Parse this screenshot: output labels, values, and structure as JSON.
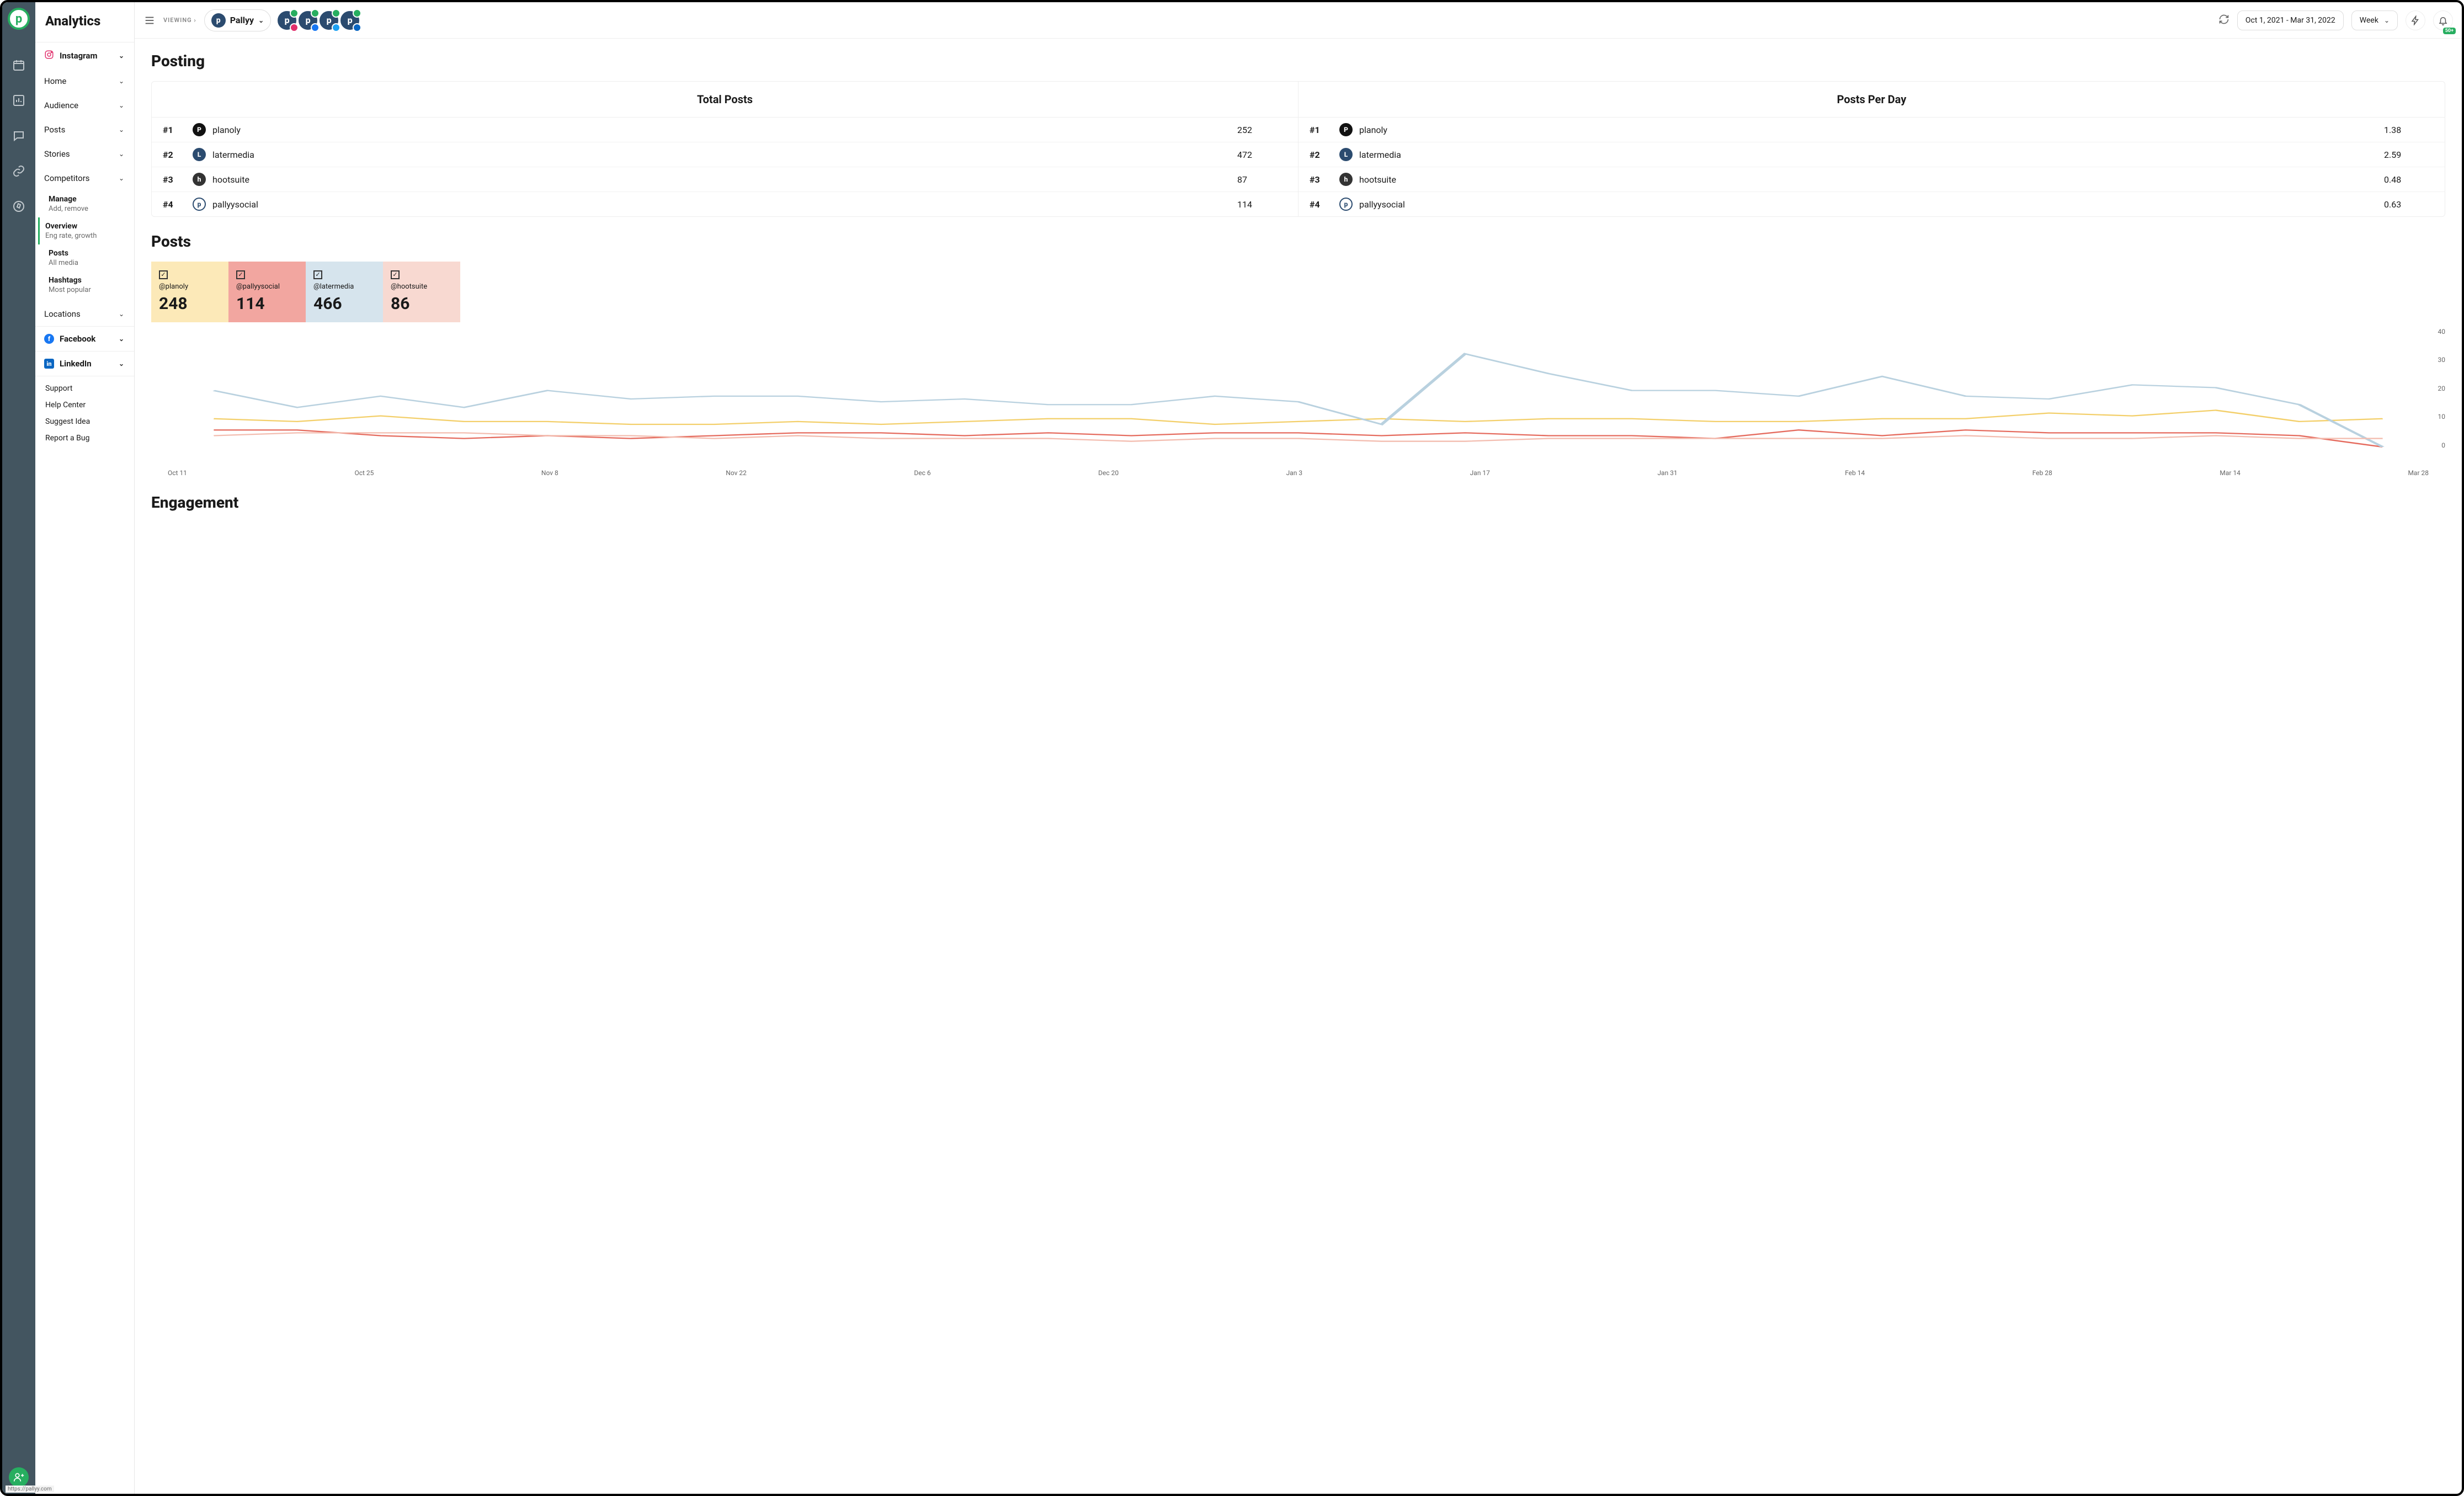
{
  "app_logo_letter": "p",
  "sidebar": {
    "title": "Analytics",
    "platforms": [
      {
        "name": "Instagram",
        "color": "#E1306C"
      },
      {
        "name": "Facebook",
        "color": "#1877F2"
      },
      {
        "name": "LinkedIn",
        "color": "#0A66C2"
      }
    ],
    "ig_nav": [
      "Home",
      "Audience",
      "Posts",
      "Stories",
      "Competitors",
      "Locations"
    ],
    "competitor_sub": [
      {
        "title": "Manage",
        "sub": "Add, remove"
      },
      {
        "title": "Overview",
        "sub": "Eng rate, growth",
        "active": true
      },
      {
        "title": "Posts",
        "sub": "All media"
      },
      {
        "title": "Hashtags",
        "sub": "Most popular"
      }
    ],
    "footer": [
      "Support",
      "Help Center",
      "Suggest Idea",
      "Report a Bug"
    ]
  },
  "topbar": {
    "viewing_label": "VIEWING",
    "account_name": "Pallyy",
    "date_range": "Oct 1, 2021 - Mar 31, 2022",
    "granularity": "Week",
    "notif_count": "50+",
    "social_networks": [
      "instagram",
      "facebook",
      "twitter",
      "linkedin"
    ],
    "net_colors": {
      "instagram": "#E1306C",
      "facebook": "#1877F2",
      "twitter": "#1DA1F2",
      "linkedin": "#0A66C2"
    }
  },
  "page": {
    "heading": "Posting",
    "total_posts_label": "Total Posts",
    "posts_per_day_label": "Posts Per Day",
    "total_posts": [
      {
        "rank": "#1",
        "name": "planoly",
        "value": "252",
        "icon_bg": "#111",
        "icon_txt": "P"
      },
      {
        "rank": "#2",
        "name": "latermedia",
        "value": "472",
        "icon_bg": "#2b4b6f",
        "icon_txt": "L"
      },
      {
        "rank": "#3",
        "name": "hootsuite",
        "value": "87",
        "icon_bg": "#333",
        "icon_txt": "h"
      },
      {
        "rank": "#4",
        "name": "pallyysocial",
        "value": "114",
        "icon_bg": "#fff",
        "icon_txt": "p",
        "icon_border": "#2b4b6f"
      }
    ],
    "posts_per_day": [
      {
        "rank": "#1",
        "name": "planoly",
        "value": "1.38",
        "icon_bg": "#111",
        "icon_txt": "P"
      },
      {
        "rank": "#2",
        "name": "latermedia",
        "value": "2.59",
        "icon_bg": "#2b4b6f",
        "icon_txt": "L"
      },
      {
        "rank": "#3",
        "name": "hootsuite",
        "value": "0.48",
        "icon_bg": "#333",
        "icon_txt": "h"
      },
      {
        "rank": "#4",
        "name": "pallyysocial",
        "value": "0.63",
        "icon_bg": "#fff",
        "icon_txt": "p",
        "icon_border": "#2b4b6f"
      }
    ],
    "posts_heading": "Posts",
    "cards": [
      {
        "handle": "@planoly",
        "value": "248",
        "checked": true
      },
      {
        "handle": "@pallyysocial",
        "value": "114",
        "checked": true
      },
      {
        "handle": "@latermedia",
        "value": "466",
        "checked": true
      },
      {
        "handle": "@hootsuite",
        "value": "86",
        "checked": true
      }
    ],
    "engagement_heading": "Engagement"
  },
  "chart_data": {
    "type": "line",
    "title": "Posts",
    "xlabel": "",
    "ylabel": "",
    "ylim": [
      0,
      40
    ],
    "y_ticks": [
      0,
      10,
      20,
      30,
      40
    ],
    "categories": [
      "Oct 11",
      "Oct 25",
      "Nov 8",
      "Nov 22",
      "Dec 6",
      "Dec 20",
      "Jan 3",
      "Jan 17",
      "Jan 31",
      "Feb 14",
      "Feb 28",
      "Mar 14",
      "Mar 28"
    ],
    "series": [
      {
        "name": "@planoly",
        "color": "#f3cf6a",
        "values": [
          10,
          9,
          11,
          9,
          9,
          8,
          8,
          9,
          8,
          9,
          10,
          10,
          8,
          9,
          10,
          9,
          10,
          10,
          9,
          9,
          10,
          10,
          12,
          11,
          13,
          9,
          10
        ]
      },
      {
        "name": "@pallyysocial",
        "color": "#e56b5e",
        "values": [
          6,
          6,
          4,
          3,
          4,
          3,
          4,
          5,
          5,
          4,
          5,
          4,
          5,
          5,
          4,
          5,
          4,
          4,
          3,
          6,
          4,
          6,
          5,
          5,
          5,
          4,
          0
        ]
      },
      {
        "name": "@latermedia",
        "color": "#b9d1df",
        "values": [
          20,
          14,
          18,
          14,
          20,
          17,
          18,
          18,
          16,
          17,
          15,
          15,
          18,
          16,
          8,
          33,
          26,
          20,
          20,
          18,
          25,
          18,
          17,
          22,
          21,
          15,
          0
        ]
      },
      {
        "name": "@hootsuite",
        "color": "#f3bdb0",
        "values": [
          4,
          5,
          5,
          5,
          4,
          4,
          3,
          4,
          3,
          3,
          3,
          2,
          3,
          3,
          2,
          2,
          3,
          3,
          3,
          3,
          3,
          4,
          3,
          3,
          4,
          3,
          3
        ]
      }
    ]
  },
  "status_url": "https://pallyy.com"
}
